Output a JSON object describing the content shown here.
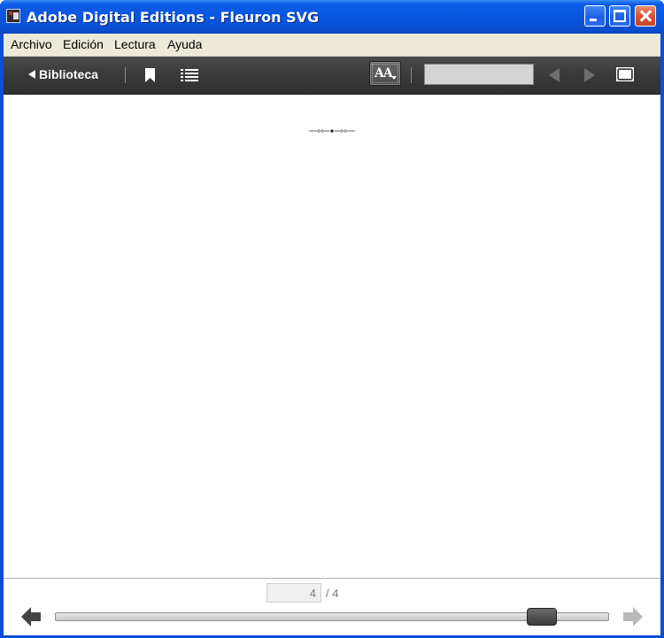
{
  "window": {
    "title": "Adobe Digital Editions - Fleuron SVG"
  },
  "menu": {
    "items": [
      "Archivo",
      "Edición",
      "Lectura",
      "Ayuda"
    ]
  },
  "toolbar": {
    "library_label": "Biblioteca",
    "font_button_label": "AA",
    "search": {
      "value": "",
      "placeholder": ""
    },
    "icons": [
      "bookmark-icon",
      "table-of-contents-icon",
      "font-size-icon",
      "previous-result-icon",
      "next-result-icon",
      "fullscreen-icon"
    ]
  },
  "content": {
    "ornament": "fleuron"
  },
  "navigation": {
    "current_page": "4",
    "total_pages": "/ 4",
    "progress": 0.9
  },
  "colors": {
    "titlebar": "#0a55dd",
    "toolbar": "#3a3a3a",
    "menubar": "#ece9d8"
  }
}
